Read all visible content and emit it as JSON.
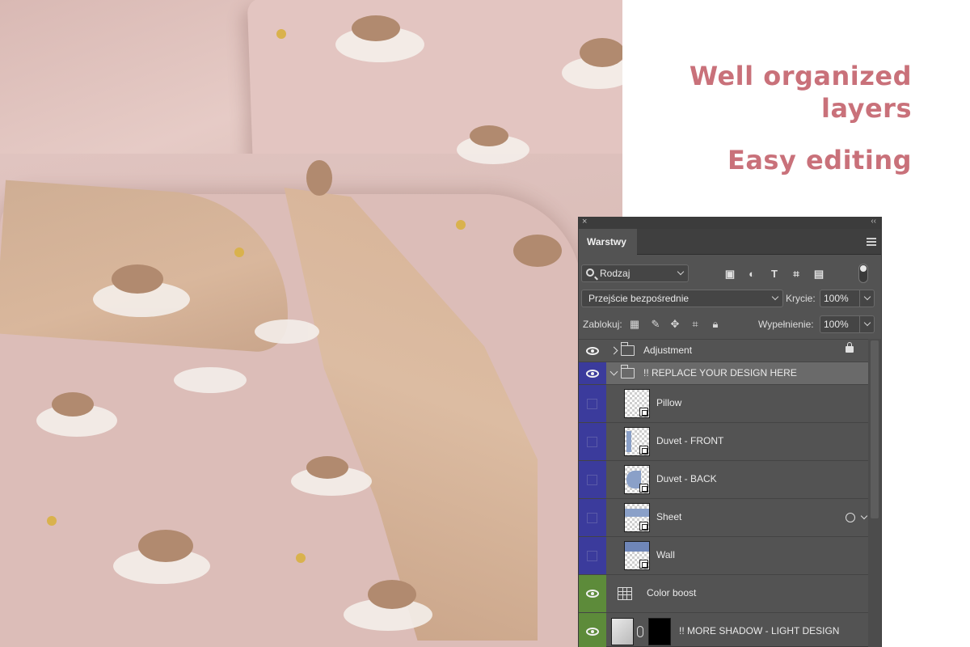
{
  "headline": {
    "line1": "Well organized",
    "line2": "layers",
    "line3": "Easy editing",
    "color": "#c9717a"
  },
  "panel": {
    "tab_label": "Warstwy",
    "filter": {
      "value": "Rodzaj",
      "icon": "search-icon"
    },
    "filter_icons": [
      "image-filter-icon",
      "adjustment-filter-icon",
      "type-filter-icon",
      "shape-filter-icon",
      "smart-object-filter-icon"
    ],
    "blend_mode": "Przejście bezpośrednie",
    "opacity_label": "Krycie:",
    "opacity_value": "100%",
    "lock_label": "Zablokuj:",
    "fill_label": "Wypełnienie:",
    "fill_value": "100%",
    "layers": [
      {
        "name": "Adjustment",
        "type": "group",
        "visible": true,
        "locked": true
      },
      {
        "name": "!! REPLACE YOUR DESIGN HERE",
        "type": "group",
        "visible": true,
        "expanded": true,
        "selected": true,
        "label_color": "#3b3b9c"
      },
      {
        "name": "Pillow",
        "type": "smart-object",
        "visible": false
      },
      {
        "name": "Duvet - FRONT",
        "type": "smart-object",
        "visible": false
      },
      {
        "name": "Duvet - BACK",
        "type": "smart-object",
        "visible": false
      },
      {
        "name": "Sheet",
        "type": "smart-object",
        "visible": false,
        "has_effects": true
      },
      {
        "name": "Wall",
        "type": "smart-object",
        "visible": false
      },
      {
        "name": "Color boost",
        "type": "adjustment",
        "visible": true,
        "label_color": "#5d8b3a"
      },
      {
        "name": "!! MORE SHADOW - LIGHT DESIGN",
        "type": "masked",
        "visible": true,
        "label_color": "#5d8b3a"
      }
    ]
  }
}
